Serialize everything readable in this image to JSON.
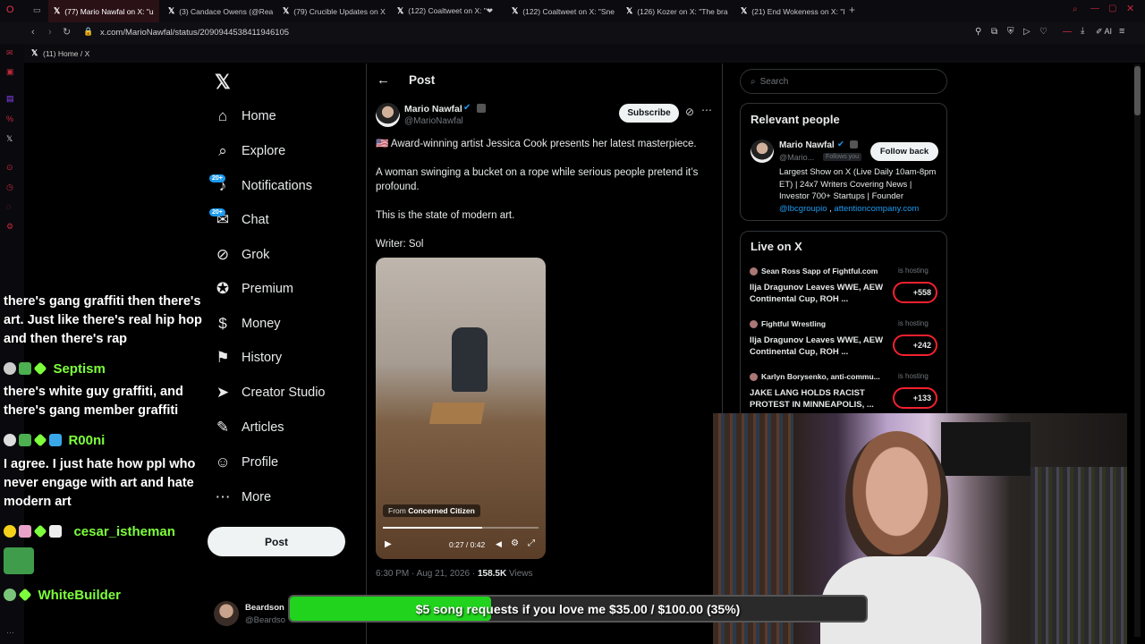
{
  "browser": {
    "tabs": [
      {
        "label": "(77) Mario Nawfal on X: \"u"
      },
      {
        "label": "(3) Candace Owens (@Rea"
      },
      {
        "label": "(79) Crucible Updates on X"
      },
      {
        "label": "(122) Coaltweet on X: \"❤"
      },
      {
        "label": "(122) Coaltweet on X: \"Sne"
      },
      {
        "label": "(126) Kozer on X: \"The bra"
      },
      {
        "label": "(21) End Wokeness on X: \"I"
      }
    ],
    "url": "x.com/MarioNawfal/status/2090944538411946105",
    "bookmark": "(11) Home / X",
    "ai_label": "AI"
  },
  "nav": {
    "items": [
      {
        "label": "Home",
        "icon": "home-icon"
      },
      {
        "label": "Explore",
        "icon": "search-icon"
      },
      {
        "label": "Notifications",
        "icon": "bell-icon",
        "badge": "20+"
      },
      {
        "label": "Chat",
        "icon": "mail-icon",
        "badge": "20+"
      },
      {
        "label": "Grok",
        "icon": "grok-icon"
      },
      {
        "label": "Premium",
        "icon": "verified-icon"
      },
      {
        "label": "Money",
        "icon": "money-icon"
      },
      {
        "label": "History",
        "icon": "bookmark-icon"
      },
      {
        "label": "Creator Studio",
        "icon": "rocket-icon"
      },
      {
        "label": "Articles",
        "icon": "article-icon"
      },
      {
        "label": "Profile",
        "icon": "person-icon"
      },
      {
        "label": "More",
        "icon": "more-icon"
      }
    ],
    "post_button": "Post",
    "account_name": "Beardson",
    "account_handle": "@Beardso"
  },
  "post": {
    "header": "Post",
    "author_name": "Mario Nawfal",
    "author_handle": "@MarioNawfal",
    "subscribe": "Subscribe",
    "line1": "🇺🇸 Award-winning artist Jessica Cook presents her latest masterpiece.",
    "line2": "A woman swinging a bucket on a rope while serious people pretend it’s profound.",
    "line3": "This is the state of modern art.",
    "line4": "Writer: Sol",
    "video_from": "From",
    "video_source": "Concerned Citizen",
    "video_time": "0:27 / 0:42",
    "video_progress": 0.64,
    "timestamp": "6:30 PM · Aug 21, 2026 ·",
    "views": "158.5K",
    "views_label": "Views"
  },
  "sidebar": {
    "search_placeholder": "Search",
    "relevant_title": "Relevant people",
    "person_name": "Mario Nawfal",
    "person_handle": "@Mario...",
    "follows_you": "Follows you",
    "follow_back": "Follow back",
    "bio": "Largest Show on X (Live Daily 10am-8pm ET) | 24x7 Writers Covering News | Investor 700+ Startups | Founder",
    "bio_link1": "@lbcgroupio",
    "bio_sep": " , ",
    "bio_link2": "attentioncompany.com",
    "live_title": "Live on X",
    "live": [
      {
        "host": "Sean Ross Sapp of Fightful.com",
        "status": "is hosting",
        "title": "Ilja Dragunov Leaves WWE, AEW Continental Cup, ROH ...",
        "count": "+558"
      },
      {
        "host": "Fightful Wrestling",
        "status": "is hosting",
        "title": "Ilja Dragunov Leaves WWE, AEW Continental Cup, ROH ...",
        "count": "+242"
      },
      {
        "host": "Karlyn Borysenko, anti-commu...",
        "status": "is hosting",
        "title": "JAKE LANG HOLDS RACIST PROTEST IN MINNEAPOLIS, ...",
        "count": "+133"
      }
    ]
  },
  "chat": {
    "msg1": "there's gang graffiti then there's art. Just like there's real hip hop and then there's rap",
    "user2": "Septism",
    "msg2": "there's white guy graffiti, and there's gang member graffiti",
    "user3": "R00ni",
    "msg3": "I agree. I just hate how ppl who never engage with art and hate modern art",
    "user4": "cesar_istheman",
    "user5": "WhiteBuilder"
  },
  "overlay": {
    "goal_text": "$5 song requests if you love me $35.00 / $100.00 (35%)",
    "goal_fraction": 0.35
  },
  "colors": {
    "accent": "#1d9bf0",
    "chat_name": "#7dff3c",
    "goal_fill": "#21d31d"
  }
}
